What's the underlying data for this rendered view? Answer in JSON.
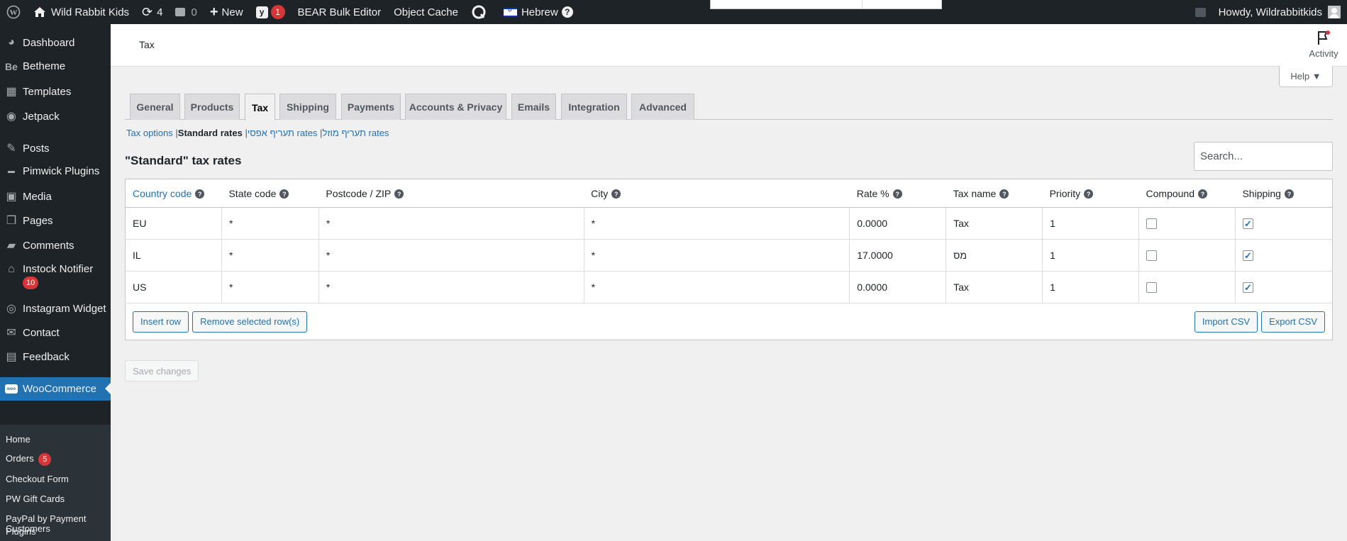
{
  "adminbar": {
    "site_name": "Wild Rabbit Kids",
    "updates_count": "4",
    "comments_count": "0",
    "new_label": "New",
    "yoast_badge": "1",
    "bear_label": "BEAR Bulk Editor",
    "object_cache_label": "Object Cache",
    "language_label": "Hebrew",
    "howdy_label": "Howdy, Wildrabbitkids"
  },
  "sidebar": {
    "items": [
      {
        "label": "Dashboard",
        "icon": "dashboard-icon"
      },
      {
        "label": "Betheme",
        "icon": "betheme-icon"
      },
      {
        "label": "Templates",
        "icon": "templates-icon"
      },
      {
        "label": "Jetpack",
        "icon": "jetpack-icon"
      },
      {
        "label": "Posts",
        "icon": "pin-icon"
      },
      {
        "label": "Pimwick Plugins",
        "icon": "pimwick-icon"
      },
      {
        "label": "Media",
        "icon": "media-icon"
      },
      {
        "label": "Pages",
        "icon": "pages-icon"
      },
      {
        "label": "Comments",
        "icon": "comments-icon"
      },
      {
        "label": "Instock Notifier",
        "icon": "notifier-icon",
        "badge": "10"
      },
      {
        "label": "Instagram Widget",
        "icon": "instagram-icon"
      },
      {
        "label": "Contact",
        "icon": "mail-icon"
      },
      {
        "label": "Feedback",
        "icon": "feedback-icon"
      },
      {
        "label": "WooCommerce",
        "icon": "woocommerce-icon"
      }
    ],
    "woo_logo_text": "woo",
    "submenu": [
      {
        "label": "Home"
      },
      {
        "label": "Orders",
        "badge": "5"
      },
      {
        "label": "Checkout Form"
      },
      {
        "label": "PW Gift Cards"
      },
      {
        "label": "PayPal by Payment Plugins"
      },
      {
        "label": "Customers"
      }
    ]
  },
  "header": {
    "title": "Tax",
    "activity_label": "Activity",
    "help_label": "Help ▼"
  },
  "tabs": [
    "General",
    "Products",
    "Tax",
    "Shipping",
    "Payments",
    "Accounts & Privacy",
    "Emails",
    "Integration",
    "Advanced"
  ],
  "active_tab": "Tax",
  "subnav": {
    "tax_options": "Tax options",
    "standard_rates": "Standard rates",
    "reduced_rates": "תעריף אפסי rates",
    "zero_rates": "תעריף מוזל rates",
    "separator": "|"
  },
  "section_title": "\"Standard\" tax rates",
  "search": {
    "placeholder": "Search..."
  },
  "table": {
    "headers": [
      "Country code",
      "State code",
      "Postcode / ZIP",
      "City",
      "Rate %",
      "Tax name",
      "Priority",
      "Compound",
      "Shipping"
    ],
    "rows": [
      {
        "country": "EU",
        "state": "*",
        "postcode": "*",
        "city": "*",
        "rate": "0.0000",
        "name": "Tax",
        "priority": "1",
        "compound": false,
        "shipping": true
      },
      {
        "country": "IL",
        "state": "*",
        "postcode": "*",
        "city": "*",
        "rate": "17.0000",
        "name": "מס",
        "priority": "1",
        "compound": false,
        "shipping": true
      },
      {
        "country": "US",
        "state": "*",
        "postcode": "*",
        "city": "*",
        "rate": "0.0000",
        "name": "Tax",
        "priority": "1",
        "compound": false,
        "shipping": true
      }
    ],
    "insert_row": "Insert row",
    "remove_rows": "Remove selected row(s)",
    "import_csv": "Import CSV",
    "export_csv": "Export CSV"
  },
  "save_changes": "Save changes",
  "colors": {
    "adminbar_bg": "#1d2327",
    "accent": "#2271b1",
    "badge": "#d63638"
  }
}
